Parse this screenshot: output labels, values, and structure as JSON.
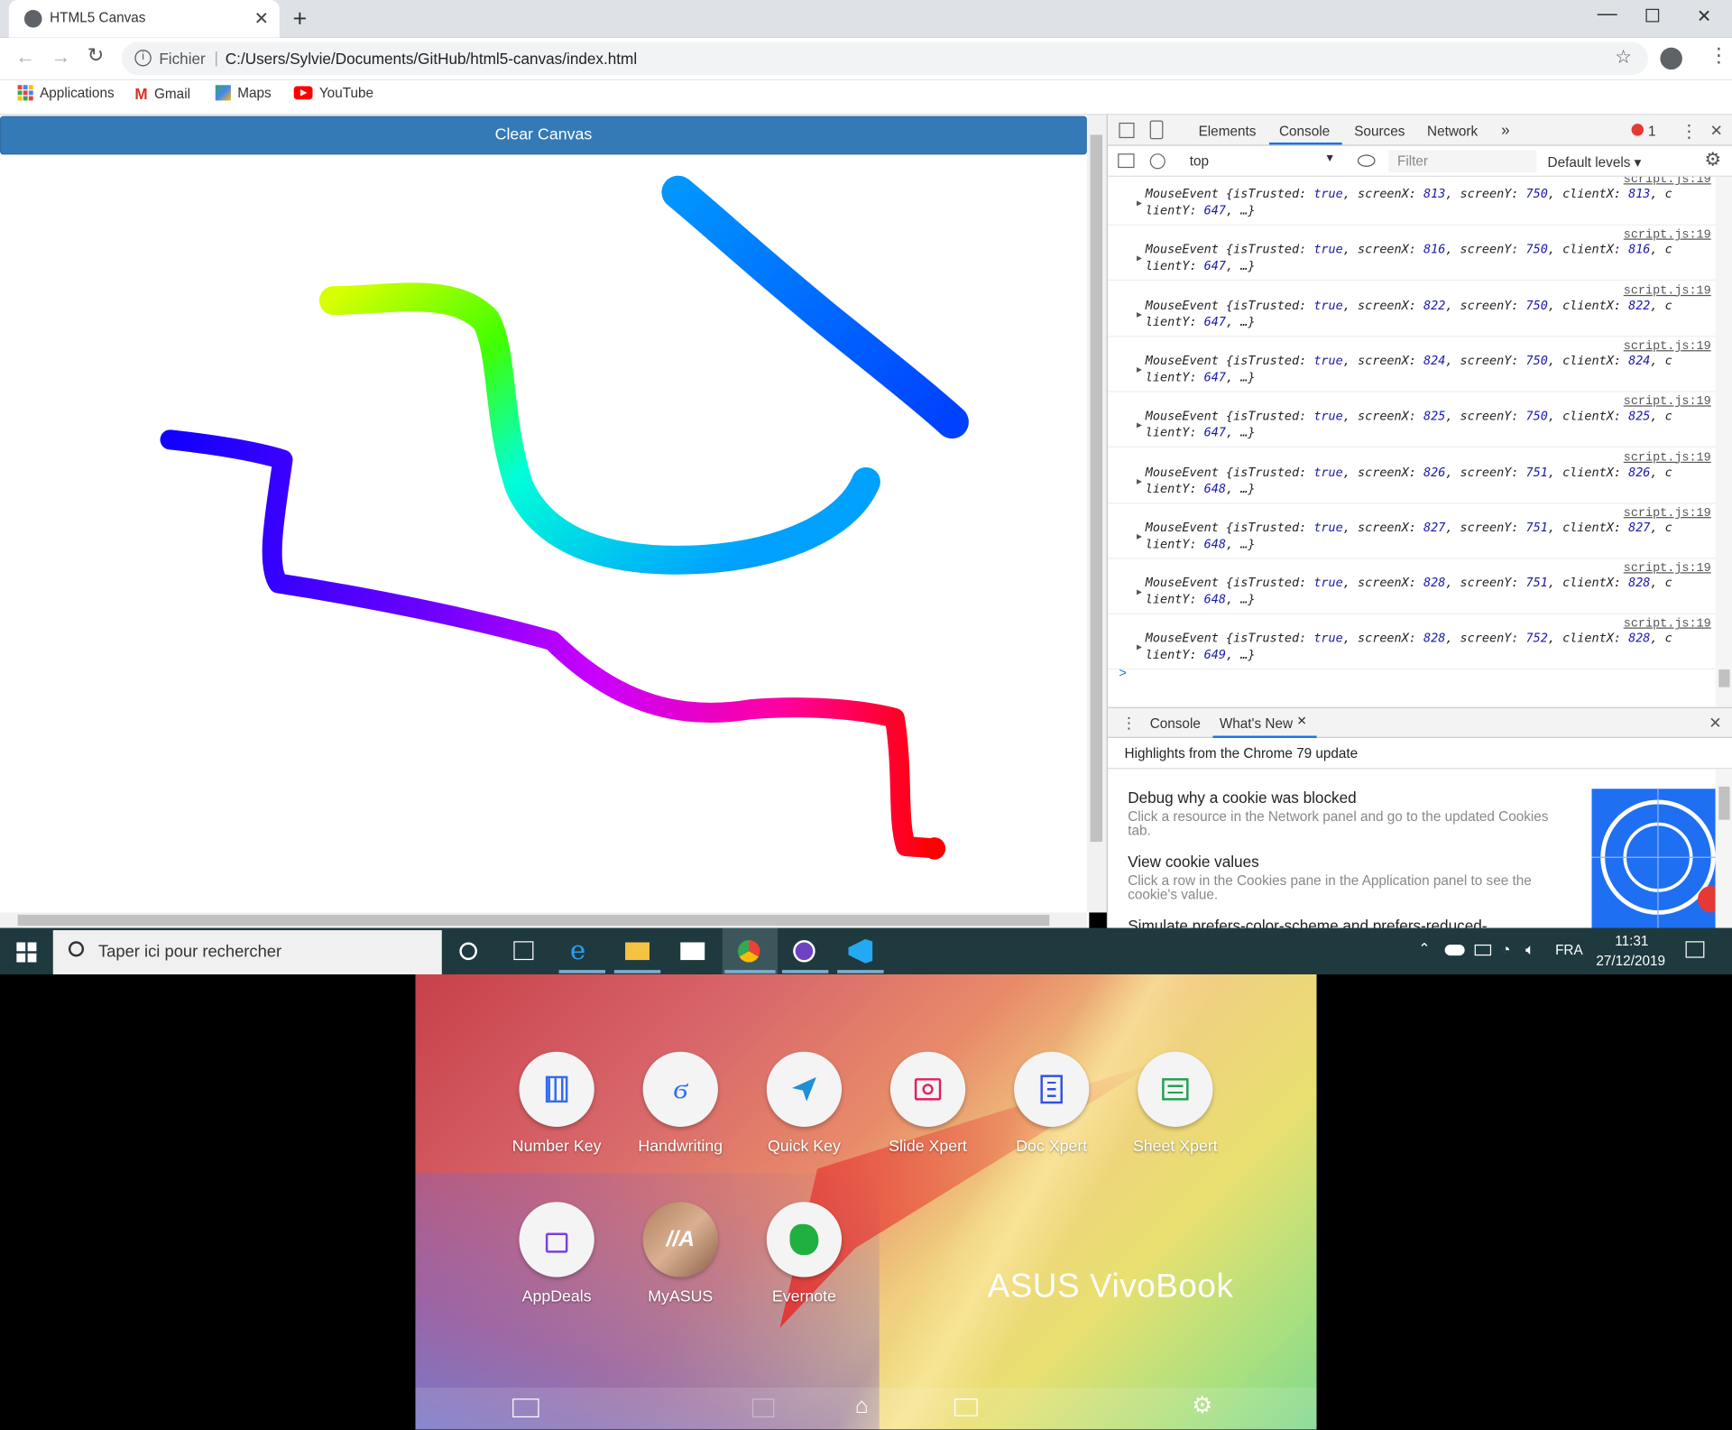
{
  "browser": {
    "tab_title": "HTML5 Canvas",
    "new_tab": "+",
    "address_scheme": "Fichier",
    "address_url": "C:/Users/Sylvie/Documents/GitHub/html5-canvas/index.html",
    "bookmarks": [
      "Applications",
      "Gmail",
      "Maps",
      "YouTube"
    ]
  },
  "page": {
    "clear_button": "Clear Canvas"
  },
  "devtools": {
    "tabs": [
      "Elements",
      "Console",
      "Sources",
      "Network"
    ],
    "active_tab": "Console",
    "more_tabs": "»",
    "error_count": "1",
    "context": "top",
    "filter_placeholder": "Filter",
    "levels": "Default levels",
    "log_source": "script.js:19",
    "logs": [
      {
        "screenX": "813",
        "screenY": "750",
        "clientX": "813",
        "clientY": "647"
      },
      {
        "screenX": "816",
        "screenY": "750",
        "clientX": "816",
        "clientY": "647"
      },
      {
        "screenX": "822",
        "screenY": "750",
        "clientX": "822",
        "clientY": "647"
      },
      {
        "screenX": "824",
        "screenY": "750",
        "clientX": "824",
        "clientY": "647"
      },
      {
        "screenX": "825",
        "screenY": "750",
        "clientX": "825",
        "clientY": "647"
      },
      {
        "screenX": "826",
        "screenY": "751",
        "clientX": "826",
        "clientY": "648"
      },
      {
        "screenX": "827",
        "screenY": "751",
        "clientX": "827",
        "clientY": "648"
      },
      {
        "screenX": "828",
        "screenY": "751",
        "clientX": "828",
        "clientY": "648"
      },
      {
        "screenX": "828",
        "screenY": "752",
        "clientX": "828",
        "clientY": "649"
      }
    ],
    "prompt": ">",
    "drawer_tabs": [
      "Console",
      "What's New"
    ],
    "drawer_header": "Highlights from the Chrome 79 update",
    "news": [
      {
        "title": "Debug why a cookie was blocked",
        "body": "Click a resource in the Network panel and go to the updated Cookies tab."
      },
      {
        "title": "View cookie values",
        "body": "Click a row in the Cookies pane in the Application panel to see the cookie's value."
      },
      {
        "title": "Simulate prefers-color-scheme and prefers-reduced-",
        "body": ""
      }
    ]
  },
  "taskbar": {
    "search_placeholder": "Taper ici pour rechercher",
    "language": "FRA",
    "time": "11:31",
    "date": "27/12/2019"
  },
  "screenpad": {
    "apps": [
      "Number Key",
      "Handwriting",
      "Quick Key",
      "Slide Xpert",
      "Doc Xpert",
      "Sheet Xpert",
      "AppDeals",
      "MyASUS",
      "Evernote"
    ],
    "brand": "ASUS VivoBook"
  },
  "colors": {
    "button_blue": "#337ab7",
    "taskbar": "#1f3a3f",
    "devtools_active": "#1a73e8"
  }
}
